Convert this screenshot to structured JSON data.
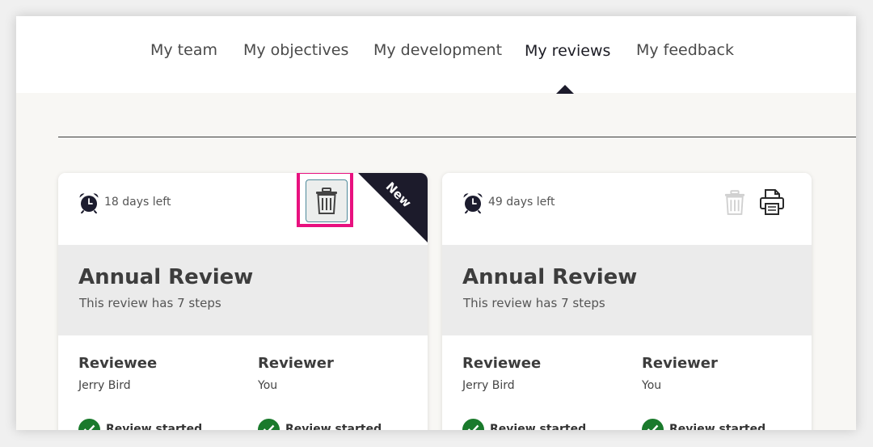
{
  "nav": {
    "items": [
      {
        "label": "My team",
        "active": false
      },
      {
        "label": "My objectives",
        "active": false
      },
      {
        "label": "My development",
        "active": false
      },
      {
        "label": "My reviews",
        "active": true
      },
      {
        "label": "My feedback",
        "active": false
      }
    ]
  },
  "cards": [
    {
      "days_left": "18 days left",
      "badge": "New",
      "title": "Annual Review",
      "steps": "This review has 7 steps",
      "reviewee_label": "Reviewee",
      "reviewee_name": "Jerry Bird",
      "reviewer_label": "Reviewer",
      "reviewer_name": "You",
      "reviewee_status": "Review started",
      "reviewer_status": "Review started",
      "delete_enabled": true,
      "highlighted": true
    },
    {
      "days_left": "49 days left",
      "title": "Annual Review",
      "steps": "This review has 7 steps",
      "reviewee_label": "Reviewee",
      "reviewee_name": "Jerry Bird",
      "reviewer_label": "Reviewer",
      "reviewer_name": "You",
      "reviewee_status": "Review started",
      "reviewer_status": "Review started",
      "delete_enabled": false,
      "print_enabled": true
    }
  ],
  "colors": {
    "highlight": "#e8117f",
    "ribbon": "#1c1b2b",
    "status_ok": "#1a7a2c",
    "band": "#ebebeb"
  },
  "icons": [
    "alarm-clock-icon",
    "trash-icon",
    "print-icon",
    "check-icon"
  ]
}
